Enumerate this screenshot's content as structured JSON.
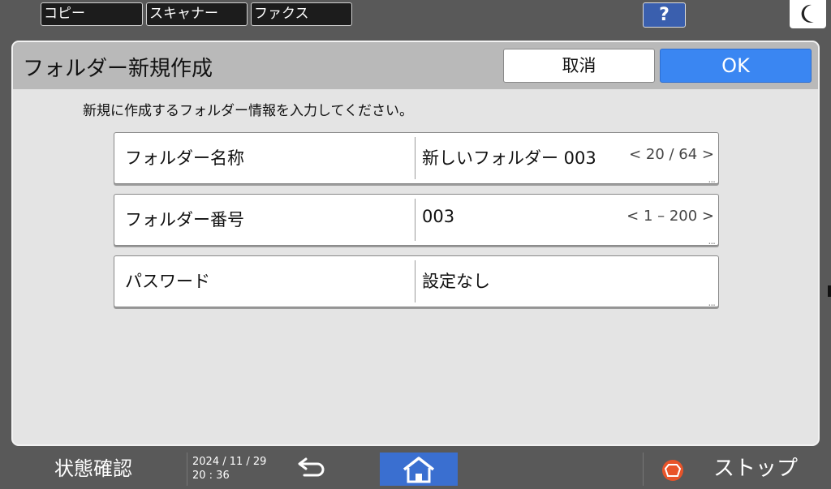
{
  "top_tabs": [
    {
      "label": "コピー"
    },
    {
      "label": "スキャナー"
    },
    {
      "label": "ファクス"
    }
  ],
  "help": {
    "label": "?"
  },
  "dialog": {
    "title": "フォルダー新規作成",
    "cancel_label": "取消",
    "ok_label": "OK",
    "instruction": "新規に作成するフォルダー情報を入力してください。",
    "fields": [
      {
        "label": "フォルダー名称",
        "value": "新しいフォルダー 003",
        "range": "< 20 / 64 >",
        "more": "..."
      },
      {
        "label": "フォルダー番号",
        "value": "003",
        "range": "< 1 – 200 >",
        "more": "..."
      },
      {
        "label": "パスワード",
        "value": "設定なし",
        "range": "",
        "more": "..."
      }
    ]
  },
  "bottom": {
    "status_label": "状態確認",
    "date": "2024 / 11 / 29",
    "time": "20 : 36",
    "stop_label": "ストップ"
  },
  "colors": {
    "accent": "#3a86f2",
    "help": "#3a5fae",
    "home": "#3a6fd0",
    "stop": "#e8542a"
  },
  "icons": [
    "moon-icon",
    "back-arrow-icon",
    "home-icon",
    "stop-icon"
  ]
}
